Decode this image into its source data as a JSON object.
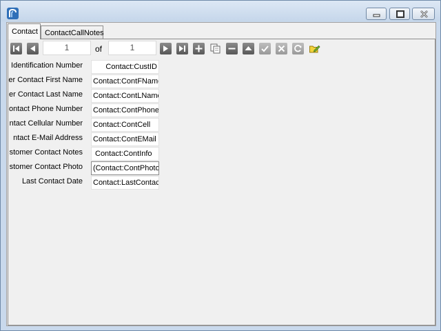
{
  "window": {
    "app_icon": "app-logo-icon",
    "controls": [
      "minimize-icon",
      "maximize-icon",
      "close-icon"
    ]
  },
  "tabs": [
    {
      "label": "Contact",
      "active": true
    },
    {
      "label": "ContactCallNotes",
      "active": false
    }
  ],
  "navigator": {
    "current_record": "1",
    "of_label": "of",
    "total_records": "1",
    "icons": [
      "first-record-icon",
      "previous-record-icon",
      "next-record-icon",
      "last-record-icon",
      "add-record-icon",
      "copy-record-icon",
      "delete-record-icon",
      "scroll-up-icon",
      "post-check-icon",
      "cancel-edit-icon",
      "refresh-icon",
      "edit-folder-icon"
    ]
  },
  "fields": [
    {
      "label": "Identification Number",
      "value": "Contact:CustID"
    },
    {
      "label": "er Contact First Name",
      "value": "Contact:ContFName"
    },
    {
      "label": "er Contact Last Name",
      "value": "Contact:ContLName"
    },
    {
      "label": "ontact Phone Number",
      "value": "Contact:ContPhone"
    },
    {
      "label": "ntact Cellular Number",
      "value": "Contact:ContCell"
    },
    {
      "label": "ntact E-Mail Address",
      "value": "Contact:ContEMail"
    },
    {
      "label": "stomer Contact Notes",
      "value": "Contact:ContInfo"
    },
    {
      "label": "stomer Contact Photo",
      "value": "(Contact:ContPhoto)"
    },
    {
      "label": "Last Contact Date",
      "value": "Contact:LastContac"
    }
  ],
  "colors": {
    "title_bar": "#c9d9ec",
    "client_bg": "#f0f0f0",
    "toolbar_dark": "#6b6b6b",
    "toolbar_light": "#aaaaaa",
    "folder_accent": "#f2d33a"
  }
}
